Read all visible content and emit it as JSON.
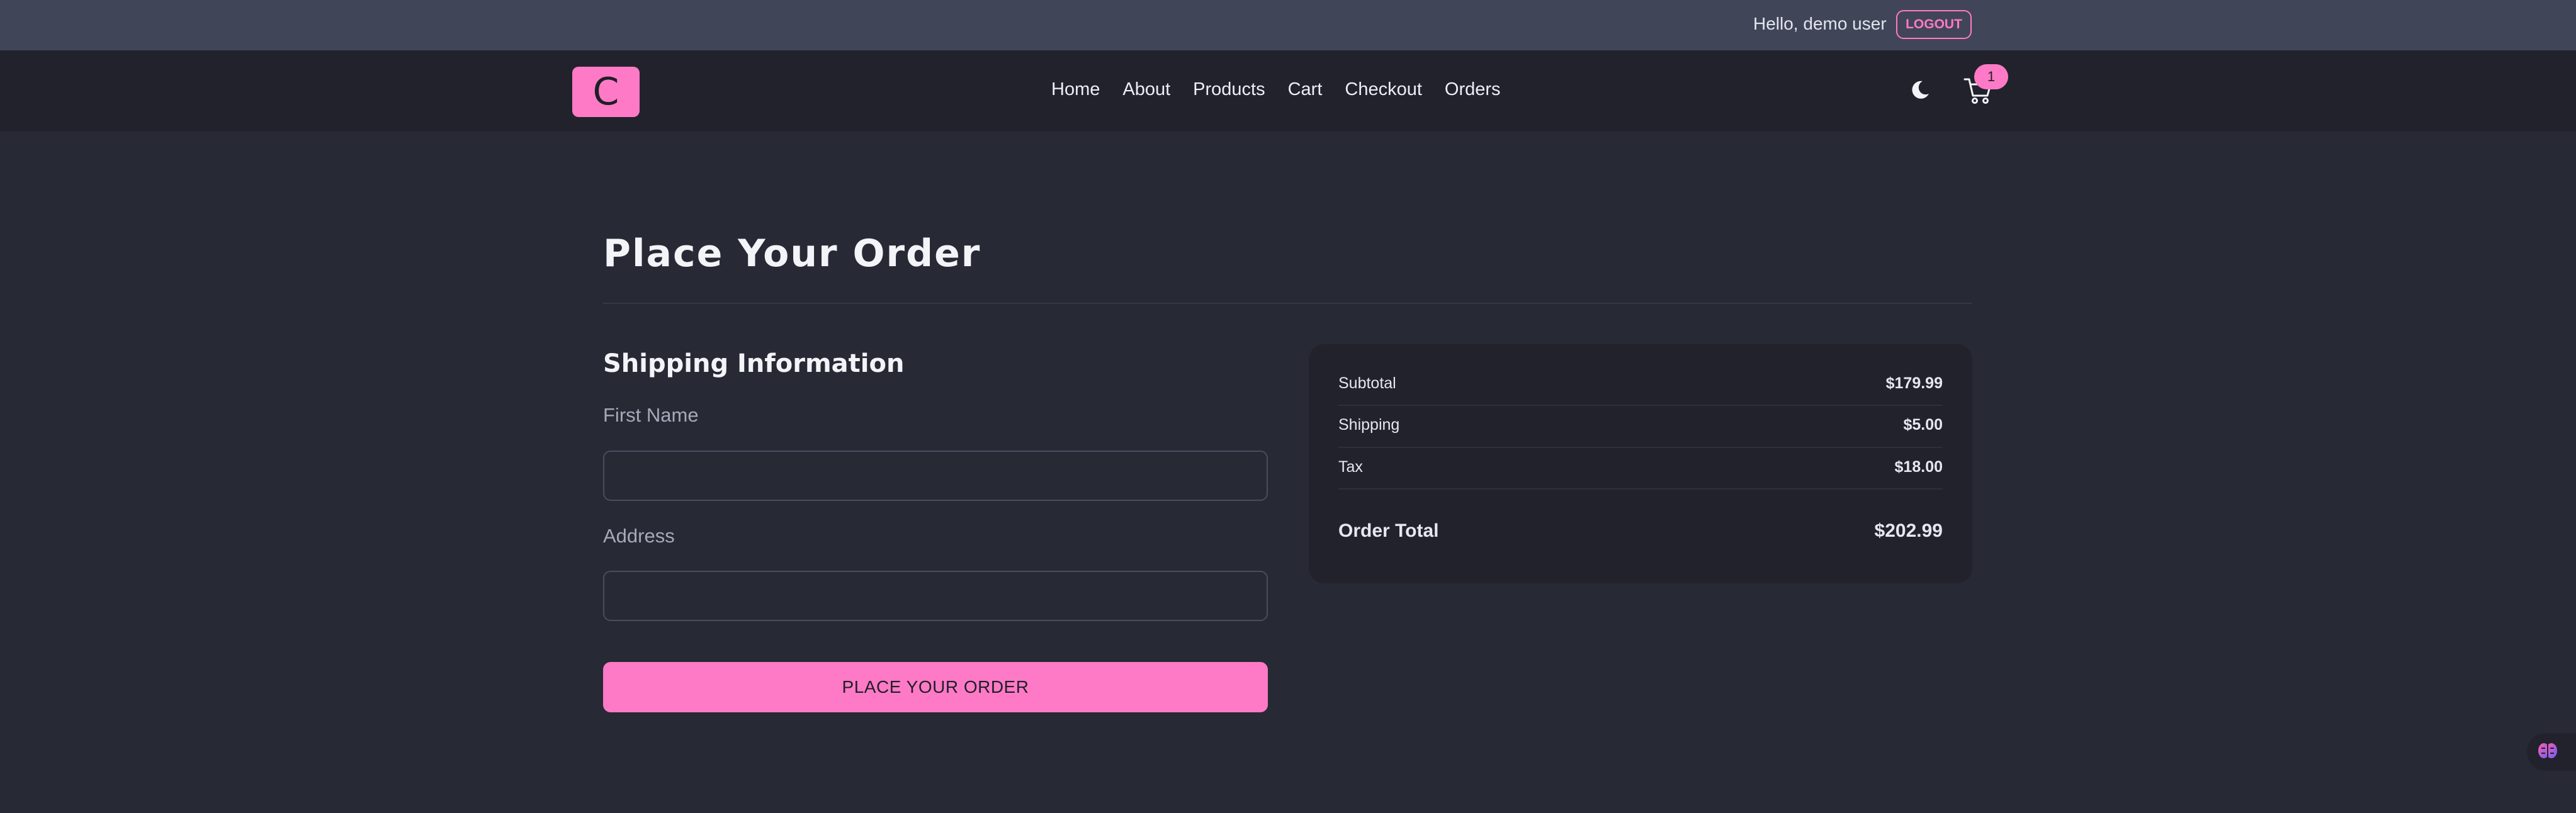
{
  "header": {
    "greeting": "Hello, demo user",
    "logout_label": "LOGOUT"
  },
  "navbar": {
    "logo_letter": "C",
    "links": [
      "Home",
      "About",
      "Products",
      "Cart",
      "Checkout",
      "Orders"
    ],
    "cart_count": "1",
    "icons": {
      "theme": "moon-icon",
      "cart": "cart-icon"
    }
  },
  "page": {
    "title": "Place Your Order"
  },
  "shipping": {
    "section_title": "Shipping Information",
    "first_name_label": "First Name",
    "first_name_value": "",
    "address_label": "Address",
    "address_value": "",
    "submit_label": "PLACE YOUR ORDER"
  },
  "summary": {
    "subtotal_label": "Subtotal",
    "subtotal_value": "$179.99",
    "shipping_label": "Shipping",
    "shipping_value": "$5.00",
    "tax_label": "Tax",
    "tax_value": "$18.00",
    "total_label": "Order Total",
    "total_value": "$202.99"
  },
  "theme": {
    "accent": "#ff7ac6",
    "background": "#272935",
    "navbar_bg": "#21222c",
    "topbar_bg": "#414558"
  }
}
